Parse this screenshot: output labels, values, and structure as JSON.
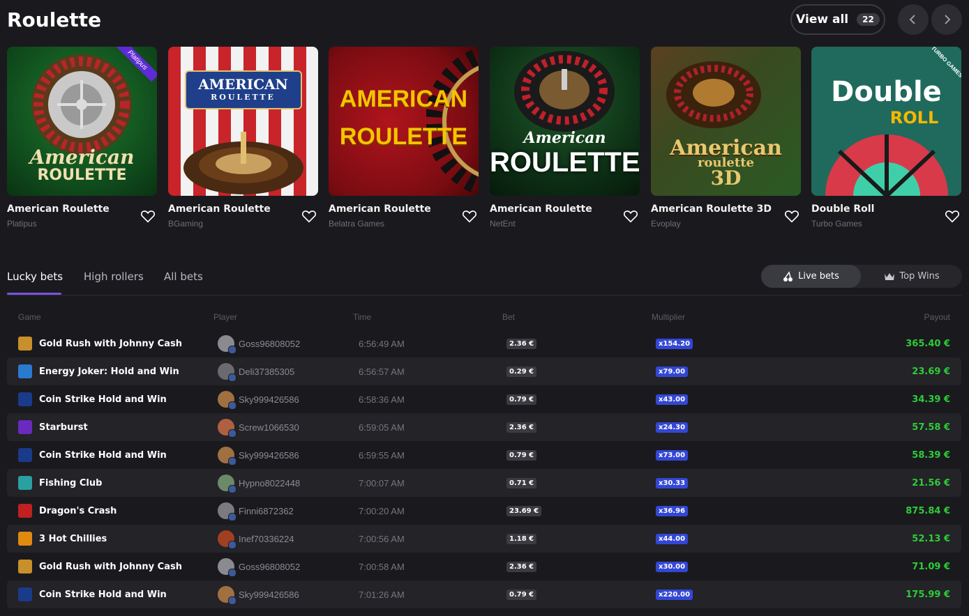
{
  "header": {
    "title": "Roulette",
    "view_all_label": "View all",
    "view_all_count": "22",
    "prev_icon": "chevron-left-icon",
    "next_icon": "chevron-right-icon"
  },
  "games": [
    {
      "name": "American Roulette",
      "provider": "Platipus",
      "badge": "Platipus",
      "thumb_line1": "American",
      "thumb_line2": "ROULETTE"
    },
    {
      "name": "American Roulette",
      "provider": "BGaming",
      "thumb_line1": "AMERICAN",
      "thumb_line2": "ROULETTE"
    },
    {
      "name": "American Roulette",
      "provider": "Belatra Games",
      "thumb_line1": "AMERICAN",
      "thumb_line2": "ROULETTE"
    },
    {
      "name": "American Roulette",
      "provider": "NetEnt",
      "thumb_line1": "American",
      "thumb_line2": "ROULETTE"
    },
    {
      "name": "American Roulette 3D",
      "provider": "Evoplay",
      "thumb_line1": "American",
      "thumb_line2": "roulette",
      "thumb_line3": "3D"
    },
    {
      "name": "Double Roll",
      "provider": "Turbo Games",
      "badge": "TURBO GAMES",
      "thumb_line1": "Double",
      "thumb_line2": "ROLL"
    }
  ],
  "tabs": {
    "items": [
      "Lucky bets",
      "High rollers",
      "All bets"
    ],
    "active": "Lucky bets"
  },
  "toggle": {
    "live_label": "Live bets",
    "top_label": "Top Wins"
  },
  "table": {
    "headers": {
      "game": "Game",
      "player": "Player",
      "time": "Time",
      "bet": "Bet",
      "multiplier": "Multiplier",
      "payout": "Payout"
    },
    "rows": [
      {
        "game": "Gold Rush with Johnny Cash",
        "player": "Goss96808052",
        "time": "6:56:49 AM",
        "bet": "2.36 €",
        "multiplier": "x154.20",
        "payout": "365.40 €"
      },
      {
        "game": "Energy Joker: Hold and Win",
        "player": "Deli37385305",
        "time": "6:56:57 AM",
        "bet": "0.29 €",
        "multiplier": "x79.00",
        "payout": "23.69 €"
      },
      {
        "game": "Coin Strike Hold and Win",
        "player": "Sky999426586",
        "time": "6:58:36 AM",
        "bet": "0.79 €",
        "multiplier": "x43.00",
        "payout": "34.39 €"
      },
      {
        "game": "Starburst",
        "player": "Screw1066530",
        "time": "6:59:05 AM",
        "bet": "2.36 €",
        "multiplier": "x24.30",
        "payout": "57.58 €"
      },
      {
        "game": "Coin Strike Hold and Win",
        "player": "Sky999426586",
        "time": "6:59:55 AM",
        "bet": "0.79 €",
        "multiplier": "x73.00",
        "payout": "58.39 €"
      },
      {
        "game": "Fishing Club",
        "player": "Hypno8022448",
        "time": "7:00:07 AM",
        "bet": "0.71 €",
        "multiplier": "x30.33",
        "payout": "21.56 €"
      },
      {
        "game": "Dragon's Crash",
        "player": "Finni6872362",
        "time": "7:00:20 AM",
        "bet": "23.69 €",
        "multiplier": "x36.96",
        "payout": "875.84 €"
      },
      {
        "game": "3 Hot Chillies",
        "player": "Inef70336224",
        "time": "7:00:56 AM",
        "bet": "1.18 €",
        "multiplier": "x44.00",
        "payout": "52.13 €"
      },
      {
        "game": "Gold Rush with Johnny Cash",
        "player": "Goss96808052",
        "time": "7:00:58 AM",
        "bet": "2.36 €",
        "multiplier": "x30.00",
        "payout": "71.09 €"
      },
      {
        "game": "Coin Strike Hold and Win",
        "player": "Sky999426586",
        "time": "7:01:26 AM",
        "bet": "0.79 €",
        "multiplier": "x220.00",
        "payout": "175.99 €"
      }
    ]
  },
  "colors": {
    "accent": "#7b53e0",
    "payout_green": "#2ecc38",
    "multiplier_blue": "#3347d6"
  }
}
